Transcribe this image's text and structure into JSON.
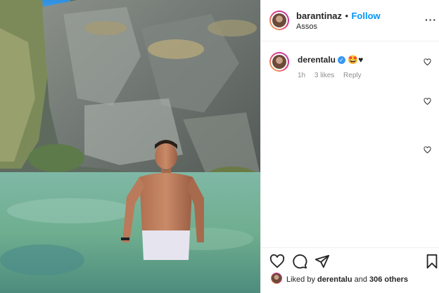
{
  "post": {
    "author": "barantinaz",
    "separator": "•",
    "follow_label": "Follow",
    "location": "Assos",
    "more_label": "···"
  },
  "comments": [
    {
      "user": "derentalu",
      "verified": true,
      "text": "🤩♥",
      "time": "1h",
      "likes": "3 likes",
      "reply": "Reply"
    }
  ],
  "actions": {
    "like": "heart-icon",
    "comment": "comment-icon",
    "share": "send-icon",
    "save": "bookmark-icon"
  },
  "likes_line": {
    "prefix": "Liked by ",
    "user": "derentalu",
    "middle": " and ",
    "others": "306 others"
  },
  "colors": {
    "follow_blue": "#0095f6",
    "verified_blue": "#3897f0",
    "story_ring": "#e23d7a"
  }
}
